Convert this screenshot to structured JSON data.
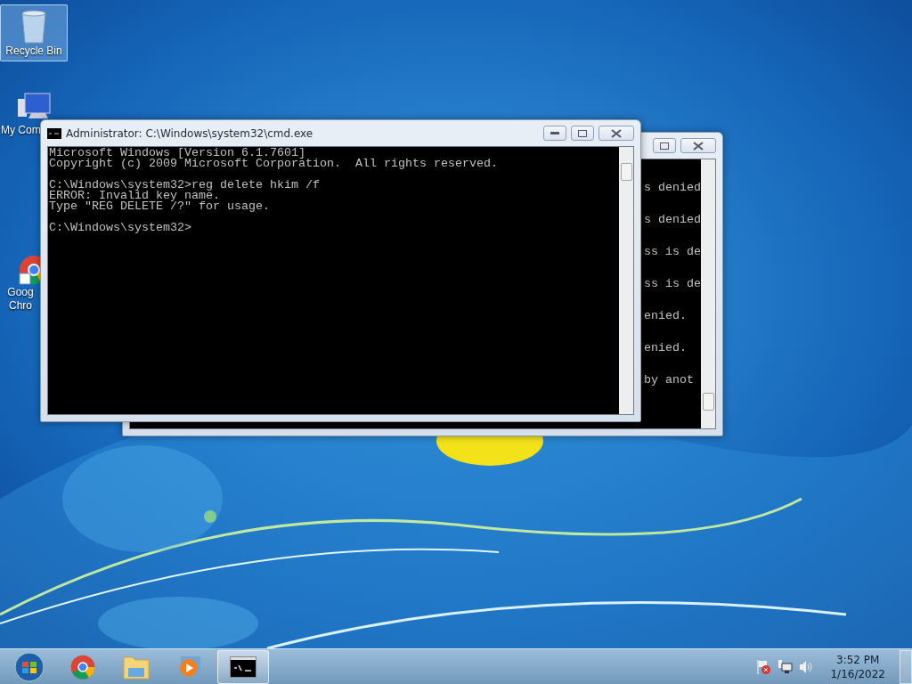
{
  "desktop_icons": [
    {
      "kind": "recycle",
      "lines": [
        "Recycle Bin"
      ],
      "selected": true
    },
    {
      "kind": "computer",
      "lines": [
        "My Com"
      ],
      "selected": false
    },
    {
      "kind": "chrome",
      "lines": [
        "Goog",
        "Chro"
      ],
      "selected": false
    }
  ],
  "back_window": {
    "lines": [
      "s denied",
      "s denied",
      "ss is de",
      "ss is de",
      "enied.",
      "enied.",
      "by anot"
    ]
  },
  "front_window": {
    "title": "Administrator: C:\\Windows\\system32\\cmd.exe",
    "paragraphs": [
      [
        "Microsoft Windows [Version 6.1.7601]",
        "Copyright (c) 2009 Microsoft Corporation.  All rights reserved."
      ],
      [
        "C:\\Windows\\system32>reg delete hkim /f",
        "ERROR: Invalid key name.",
        "Type \"REG DELETE /?\" for usage."
      ],
      [
        "C:\\Windows\\system32>"
      ]
    ]
  },
  "taskbar": {
    "items": [
      {
        "kind": "start",
        "selected": false
      },
      {
        "kind": "chrome",
        "selected": false
      },
      {
        "kind": "explorer",
        "selected": false
      },
      {
        "kind": "media",
        "selected": false
      },
      {
        "kind": "cmd",
        "selected": true
      }
    ],
    "tray": [
      {
        "kind": "flag"
      },
      {
        "kind": "network"
      },
      {
        "kind": "volume"
      }
    ],
    "time": "3:52 PM",
    "date": "1/16/2022"
  }
}
